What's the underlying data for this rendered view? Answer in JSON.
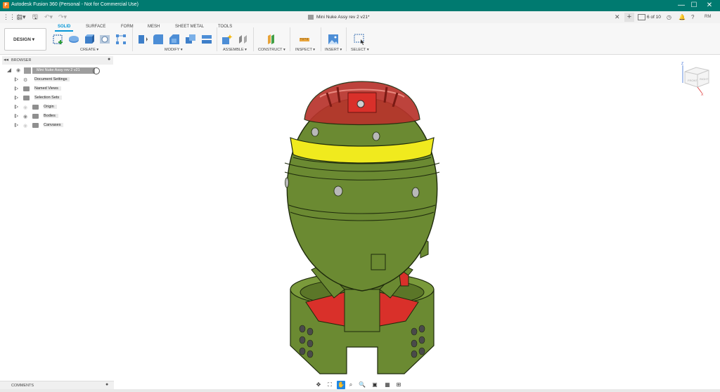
{
  "window": {
    "title": "Autodesk Fusion 360 (Personal - Not for Commercial Use)",
    "app_icon": "F",
    "minimize": "—",
    "maximize": "☐",
    "close": "✕"
  },
  "tabbar": {
    "document_title": "Mini Nuke Assy rev 2 v21*",
    "close_tab": "✕",
    "new_tab": "+",
    "job_status": "6 of 10",
    "user_initials": "RM"
  },
  "toolbar": {
    "workspace": "DESIGN ▾",
    "tabs": [
      "SOLID",
      "SURFACE",
      "FORM",
      "MESH",
      "SHEET METAL",
      "TOOLS"
    ],
    "active_tab": "SOLID",
    "groups": [
      "CREATE ▾",
      "MODIFY ▾",
      "ASSEMBLE ▾",
      "CONSTRUCT ▾",
      "INSPECT ▾",
      "INSERT ▾",
      "SELECT ▾"
    ]
  },
  "browser": {
    "header": "BROWSER",
    "root": "Mini Nuke Assy rev 2 v21",
    "items": [
      {
        "label": "Document Settings",
        "icon": "gear-icon"
      },
      {
        "label": "Named Views",
        "icon": "folder-icon"
      },
      {
        "label": "Selection Sets",
        "icon": "folder-icon"
      },
      {
        "label": "Origin",
        "icon": "folder-icon"
      },
      {
        "label": "Bodies",
        "icon": "folder-icon"
      },
      {
        "label": "Canvases",
        "icon": "folder-icon"
      }
    ]
  },
  "viewcube": {
    "front": "FRONT",
    "right": "RIGHT",
    "axis_z": "Z",
    "axis_x": "X"
  },
  "comments": {
    "header": "COMMENTS"
  },
  "colors": {
    "titlebar": "#007a70",
    "accent": "#0696d7",
    "model_green": "#6b8a32",
    "model_red": "#d9302a",
    "model_yellow": "#f0ea1e"
  }
}
